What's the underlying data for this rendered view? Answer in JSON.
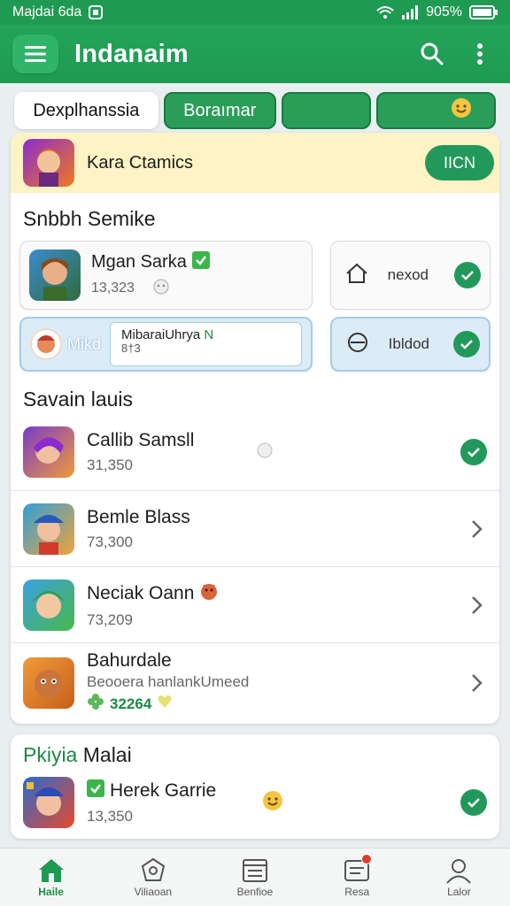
{
  "status": {
    "time": "Majdai 6da",
    "battery": "905%"
  },
  "appbar": {
    "title": "Indanaim"
  },
  "tabs": [
    {
      "label": "Dexplhanssia"
    },
    {
      "label": "Boraımar"
    },
    {
      "label": ""
    },
    {
      "label": ""
    }
  ],
  "banner": {
    "title": "Kara Ctamics",
    "button": "IICN"
  },
  "section1": {
    "title": "Snbbh Semike"
  },
  "grid": {
    "row1": {
      "name": "Mgan Sarka",
      "value": "13,323",
      "right_label": "nexod"
    },
    "row2": {
      "left_label": "Mikd",
      "input_line1": "MibaraiUhrya",
      "input_green": "N",
      "input_line2": "8†3",
      "right_label": "Ibldod"
    }
  },
  "section2": {
    "title": "Savain lauis"
  },
  "list": [
    {
      "name": "Callib Samsll",
      "sub": "31,350",
      "trail": "check"
    },
    {
      "name": "Bemle Blass",
      "sub": "73,300",
      "trail": "chevron"
    },
    {
      "name": "Neciak Oann",
      "sub": "73,209",
      "trail": "chevron"
    },
    {
      "name": "Bahurdale",
      "sub": "Beooera hanlankUmeed",
      "sub2": "32264",
      "trail": "chevron"
    }
  ],
  "section3": {
    "title_green": "Pkiyia",
    "title_rest": "Malai"
  },
  "section3_item": {
    "name": "Herek Garrie",
    "sub": "13,350"
  },
  "nav": [
    {
      "label": "Haile"
    },
    {
      "label": "Viliaoan"
    },
    {
      "label": "Benfioe"
    },
    {
      "label": "Resa"
    },
    {
      "label": "Lalor"
    }
  ],
  "colors": {
    "accent": "#22995a",
    "banner": "#fdf3c4",
    "blue_card": "#dcecf7"
  }
}
